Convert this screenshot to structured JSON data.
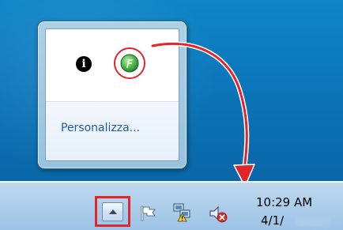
{
  "popup": {
    "icons": {
      "info_icon": "info-icon",
      "info_glyph": "i",
      "app_icon": "green-app-icon",
      "highlight": "red-circle-highlight"
    },
    "customize_label": "Personalizza..."
  },
  "annotation": {
    "arrow_icon": "red-curved-arrow",
    "color": "#e0262b"
  },
  "taskbar": {
    "show_hidden_icon": "chevron-up-icon",
    "highlight_color": "#e0262b",
    "action_center_icon": "flag-icon",
    "network_icon": "network-warning-icon",
    "volume_icon": "volume-muted-icon",
    "clock": {
      "time": "10:29 AM",
      "date": "4/1/"
    }
  },
  "colors": {
    "desktop": "#0a73b6",
    "link": "#1f5aa6",
    "taskbar": "#9cc3e6"
  }
}
